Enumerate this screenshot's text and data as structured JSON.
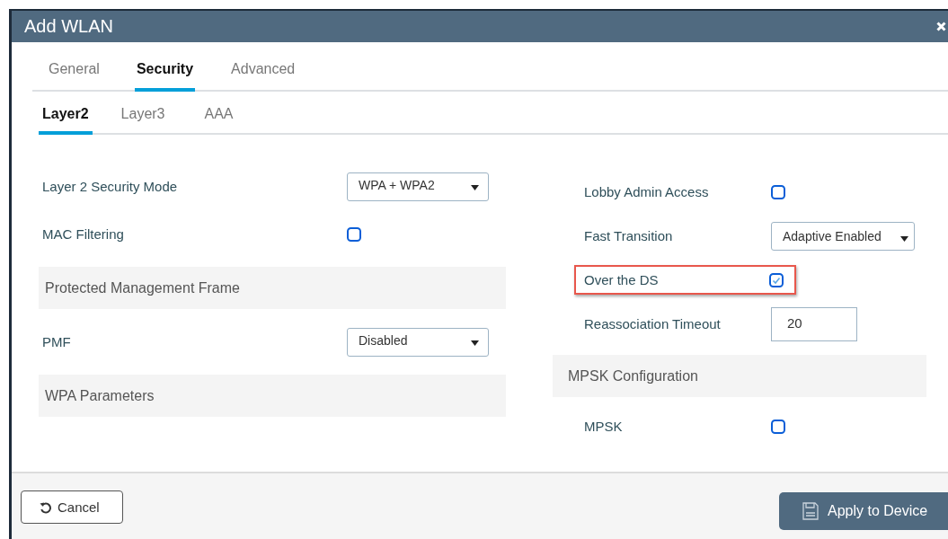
{
  "dialog": {
    "title": "Add WLAN"
  },
  "tabs": [
    {
      "label": "General",
      "selected": false
    },
    {
      "label": "Security",
      "selected": true
    },
    {
      "label": "Advanced",
      "selected": false
    }
  ],
  "subtabs": [
    {
      "label": "Layer2",
      "selected": true
    },
    {
      "label": "Layer3",
      "selected": false
    },
    {
      "label": "AAA",
      "selected": false
    }
  ],
  "left_column": [
    {
      "kind": "select",
      "label": "Layer 2 Security Mode",
      "value": "WPA + WPA2"
    },
    {
      "kind": "checkbox",
      "label": "MAC Filtering",
      "checked": false
    },
    {
      "kind": "section",
      "label": "Protected Management Frame"
    },
    {
      "kind": "select",
      "label": "PMF",
      "value": "Disabled"
    },
    {
      "kind": "section",
      "label": "WPA Parameters"
    }
  ],
  "right_column": [
    {
      "kind": "checkbox",
      "label": "Lobby Admin Access",
      "checked": false,
      "highlighted": false
    },
    {
      "kind": "select",
      "label": "Fast Transition",
      "value": "Adaptive Enabled"
    },
    {
      "kind": "checkbox",
      "label": "Over the DS",
      "checked": true,
      "highlighted": true
    },
    {
      "kind": "text",
      "label": "Reassociation Timeout",
      "value": "20"
    },
    {
      "kind": "section",
      "label": "MPSK Configuration"
    },
    {
      "kind": "checkbox",
      "label": "MPSK",
      "checked": false,
      "highlighted": false
    }
  ],
  "footer": {
    "cancel": "Cancel",
    "apply": "Apply to Device"
  }
}
